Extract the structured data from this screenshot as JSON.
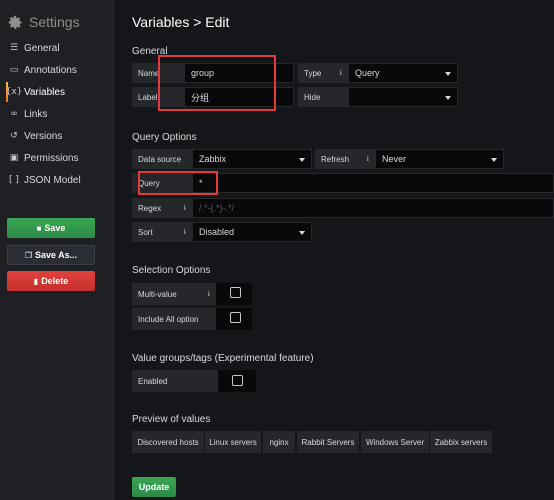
{
  "sidebar": {
    "title": "Settings",
    "items": [
      {
        "label": "General",
        "icon": "sliders-icon"
      },
      {
        "label": "Annotations",
        "icon": "comment-icon"
      },
      {
        "label": "Variables",
        "icon": "braces-icon"
      },
      {
        "label": "Links",
        "icon": "link-icon"
      },
      {
        "label": "Versions",
        "icon": "history-icon"
      },
      {
        "label": "Permissions",
        "icon": "lock-icon"
      },
      {
        "label": "JSON Model",
        "icon": "brackets-icon"
      }
    ],
    "save_label": "Save",
    "save_as_label": "Save As...",
    "delete_label": "Delete"
  },
  "main": {
    "title": "Variables > Edit",
    "general": {
      "heading": "General",
      "name_label": "Name",
      "name_value": "group",
      "type_label": "Type",
      "type_value": "Query",
      "label_label": "Label",
      "label_value": "分组",
      "hide_label": "Hide",
      "hide_value": ""
    },
    "query_options": {
      "heading": "Query Options",
      "datasource_label": "Data source",
      "datasource_value": "Zabbix",
      "refresh_label": "Refresh",
      "refresh_value": "Never",
      "query_label": "Query",
      "query_value": "*",
      "regex_label": "Regex",
      "regex_placeholder": "/.*-(.*)-.*/",
      "sort_label": "Sort",
      "sort_value": "Disabled"
    },
    "selection_options": {
      "heading": "Selection Options",
      "multi_value_label": "Multi-value",
      "include_all_label": "Include All option"
    },
    "value_groups": {
      "heading": "Value groups/tags (Experimental feature)",
      "enabled_label": "Enabled"
    },
    "preview": {
      "heading": "Preview of values",
      "values": [
        "Discovered hosts",
        "Linux servers",
        "nginx",
        "Rabbit Servers",
        "Windows Server",
        "Zabbix servers"
      ]
    },
    "update_label": "Update"
  },
  "colors": {
    "accent_save": "#3aa655",
    "accent_delete": "#e0423e",
    "highlight_box": "#e23b3b",
    "active_indicator": "#eb7b18"
  }
}
